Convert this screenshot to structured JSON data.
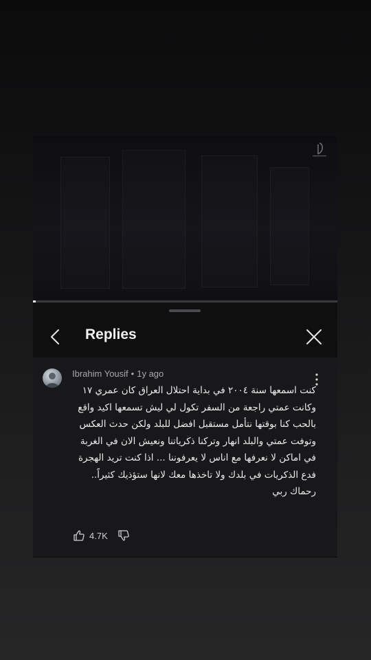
{
  "video": {
    "progress": 0.01
  },
  "header": {
    "title": "Replies"
  },
  "comment": {
    "author": "Ibrahim Yousif",
    "separator": "•",
    "time": "1y ago",
    "text": "كنت اسمعها سنة ٢٠٠٤ في بداية احتلال العراق كان عمري ١٧  وكانت عمتي راجعة من السفر تكول لي ليش تسمعها اكيد واقع بالحب كنا بوقتها نتأمل مستقبل افضل للبلد ولكن حدث العكس وتوفت عمتي والبلد انهار وتركنا ذكرياتنا ونعيش الان في الغربة في اماكن لا نعرفها مع اناس لا يعرفوننا ... اذا كنت تريد الهجرة فدع الذكريات في بلدك ولا تاخذها معك لانها ستؤذيك كثيراً.. رحماك ربي",
    "likes": "4.7K"
  },
  "icons": {
    "back": "chevron-left-icon",
    "close": "close-icon",
    "more": "more-vertical-icon",
    "like": "thumb-up-icon",
    "dislike": "thumb-down-icon"
  }
}
